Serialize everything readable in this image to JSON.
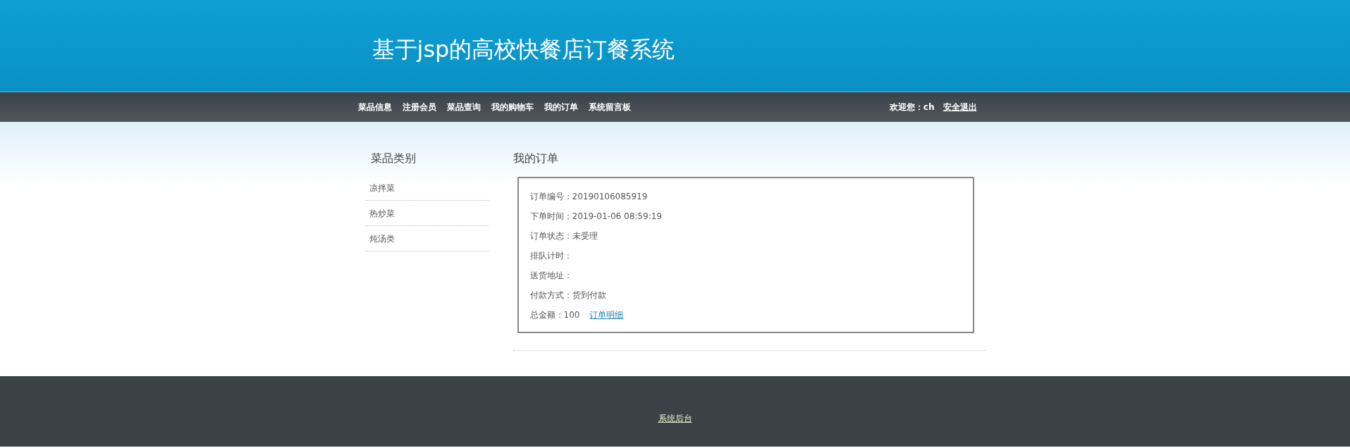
{
  "header": {
    "title": "基于jsp的高校快餐店订餐系统"
  },
  "nav": {
    "items": [
      "菜品信息",
      "注册会员",
      "菜品查询",
      "我的购物车",
      "我的订单",
      "系统留言板"
    ],
    "welcome": "欢迎您：ch",
    "logout": "安全退出"
  },
  "sidebar": {
    "title": "菜品类别",
    "items": [
      "凉拌菜",
      "热炒菜",
      "炖汤类"
    ]
  },
  "main": {
    "title": "我的订单",
    "order": {
      "fields": [
        {
          "label": "订单编号：",
          "value": "20190106085919"
        },
        {
          "label": "下单时间：",
          "value": "2019-01-06 08:59:19"
        },
        {
          "label": "订单状态：",
          "value": "未受理"
        },
        {
          "label": "排队计时："
        },
        {
          "label": "送货地址："
        },
        {
          "label": "付款方式：",
          "value": "货到付款"
        }
      ],
      "total": {
        "label": "总金额：",
        "value": "100"
      },
      "detail_link": "订单明细"
    }
  },
  "footer": {
    "link": "系统后台"
  }
}
